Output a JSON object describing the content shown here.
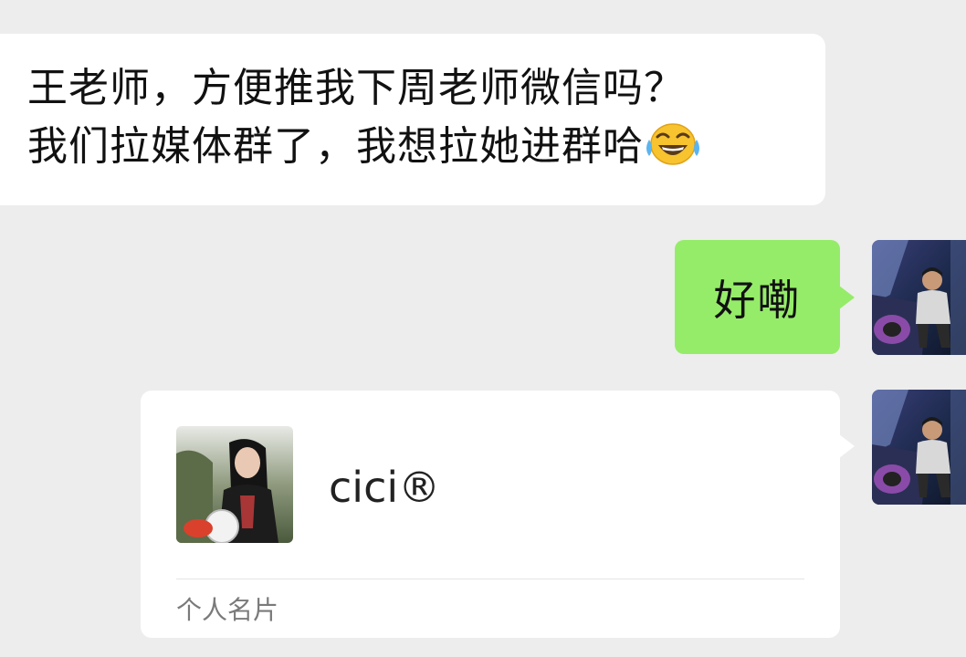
{
  "messages": {
    "incoming": {
      "line1": "王老师，方便推我下周老师微信吗？",
      "line2": "我们拉媒体群了，我想拉她进群哈",
      "emoji_icon": "tears-of-joy-emoji"
    },
    "outgoing": {
      "text": "好嘞"
    },
    "contact_card": {
      "name": "cici®",
      "label": "个人名片"
    }
  },
  "colors": {
    "background": "#ededed",
    "incoming_bubble": "#ffffff",
    "outgoing_bubble": "#95ec69",
    "card_label": "#7a7a7a"
  }
}
